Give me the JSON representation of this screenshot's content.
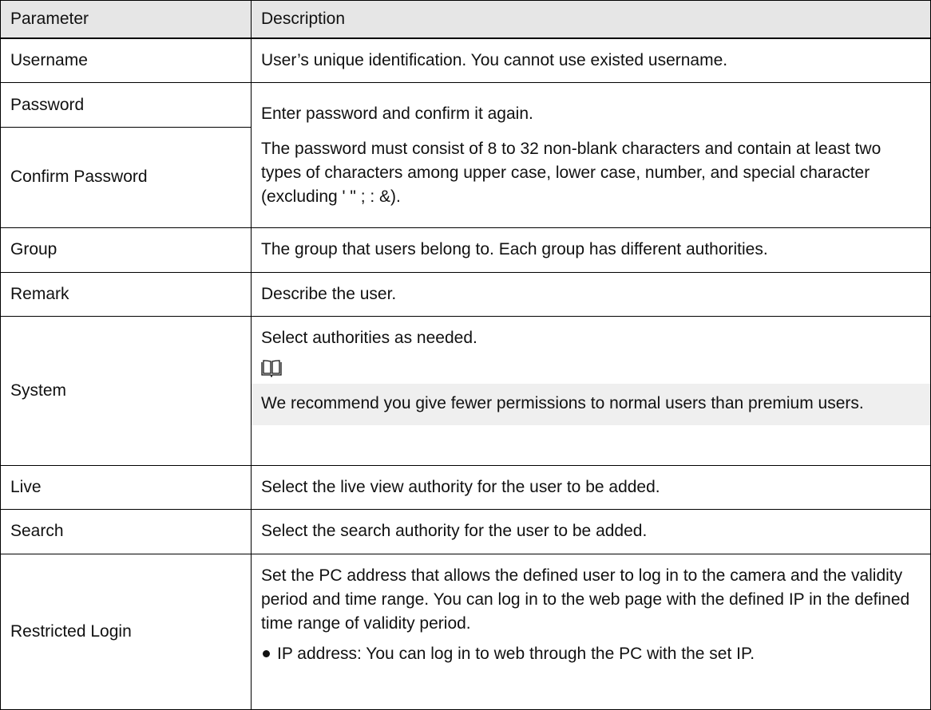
{
  "table": {
    "headers": {
      "parameter": "Parameter",
      "description": "Description"
    },
    "rows": {
      "username": {
        "param": "Username",
        "desc": "User’s unique identification. You cannot use existed username."
      },
      "password": {
        "param": "Password"
      },
      "confirm_password": {
        "param": "Confirm Password"
      },
      "password_desc": {
        "line1": "Enter password and confirm it again.",
        "line2": "The password must consist of 8 to 32 non-blank characters and contain at least two types of characters among upper case, lower case, number, and special character (excluding ' \" ; : &)."
      },
      "group": {
        "param": "Group",
        "desc": "The group that users belong to. Each group has different authorities."
      },
      "remark": {
        "param": "Remark",
        "desc": "Describe the user."
      },
      "system": {
        "param": "System",
        "desc": "Select authorities as needed.",
        "note_icon": "book-icon",
        "note": "We recommend you give fewer permissions to normal users than premium users."
      },
      "live": {
        "param": "Live",
        "desc": "Select the live view authority for the user to be added."
      },
      "search": {
        "param": "Search",
        "desc": "Select the search authority for the user to be added."
      },
      "restricted_login": {
        "param": "Restricted Login",
        "desc": "Set the PC address that allows the defined user to log in to the camera and the validity period and time range. You can log in to the web page with the defined IP in the defined time range of validity period.",
        "bullet": "IP address: You can log in to web through the PC with the set IP."
      }
    }
  },
  "colors": {
    "header_bg": "#e6e6e6",
    "note_bg": "#efefef",
    "border": "#000000"
  }
}
